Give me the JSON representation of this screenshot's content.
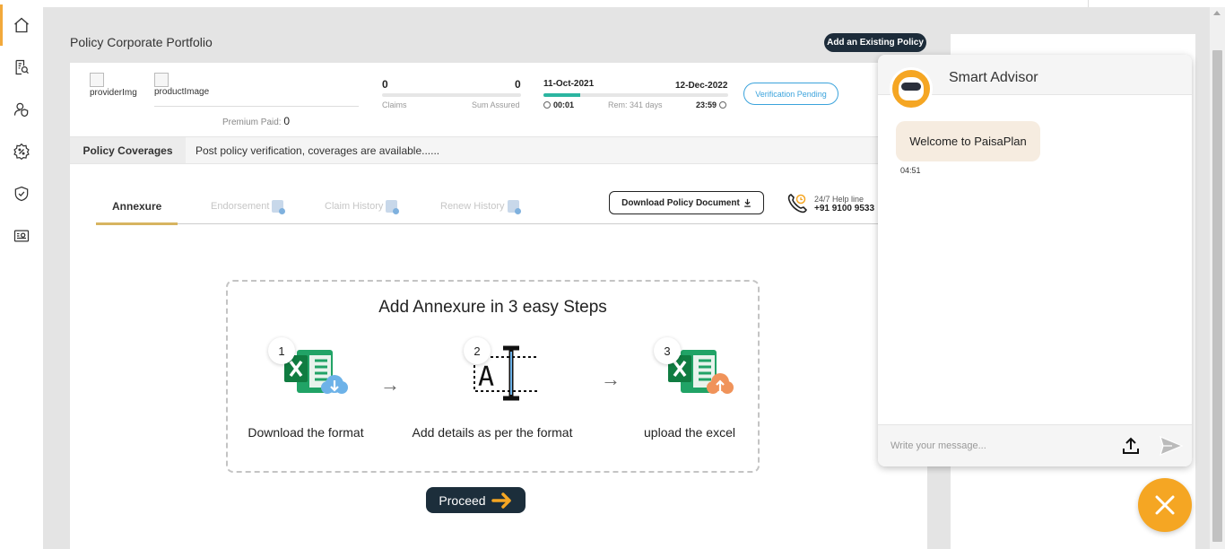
{
  "page": {
    "title": "Policy Corporate Portfolio",
    "add_policy_label": "Add an Existing Policy"
  },
  "sidebar": {
    "items": [
      {
        "name": "home-icon",
        "active": true
      },
      {
        "name": "search-document-icon",
        "active": false
      },
      {
        "name": "user-shield-icon",
        "active": false
      },
      {
        "name": "discount-icon",
        "active": false
      },
      {
        "name": "shield-check-icon",
        "active": false
      },
      {
        "name": "id-card-icon",
        "active": false
      }
    ]
  },
  "policy": {
    "provider_img_alt": "providerImg",
    "product_img_alt": "productImage",
    "premium_label": "Premium Paid:",
    "premium_value": "0",
    "claims_value": "0",
    "claims_label": "Claims",
    "sum_assured_value": "0",
    "sum_assured_label": "Sum Assured",
    "start_date": "11-Oct-2021",
    "end_date": "12-Dec-2022",
    "start_time": "00:01",
    "end_time": "23:59",
    "remaining": "Rem: 341 days",
    "progress_fraction": 0.2,
    "verification_label": "Verification Pending"
  },
  "coverage": {
    "label": "Policy Coverages",
    "text": "Post policy verification, coverages are available......"
  },
  "tabs": [
    {
      "label": "Annexure",
      "active": true
    },
    {
      "label": "Endorsement",
      "active": false
    },
    {
      "label": "Claim History",
      "active": false
    },
    {
      "label": "Renew History",
      "active": false
    }
  ],
  "actions": {
    "download_label": "Download Policy Document",
    "help_small": "24/7 Help line",
    "help_number": "+91 9100 9533"
  },
  "steps": {
    "title": "Add Annexure in 3 easy Steps",
    "items": [
      {
        "num": "1",
        "label": "Download the format"
      },
      {
        "num": "2",
        "label": "Add details as per the format"
      },
      {
        "num": "3",
        "label": "upload the excel"
      }
    ],
    "proceed_label": "Proceed"
  },
  "chat": {
    "title": "Smart Advisor",
    "message": "Welcome to PaisaPlan",
    "message_time": "04:51",
    "input_placeholder": "Write your message..."
  },
  "colors": {
    "accent": "#f5a623",
    "dark": "#1c2e3b",
    "teal": "#2bb5a0",
    "link_blue": "#3ba3dc"
  }
}
